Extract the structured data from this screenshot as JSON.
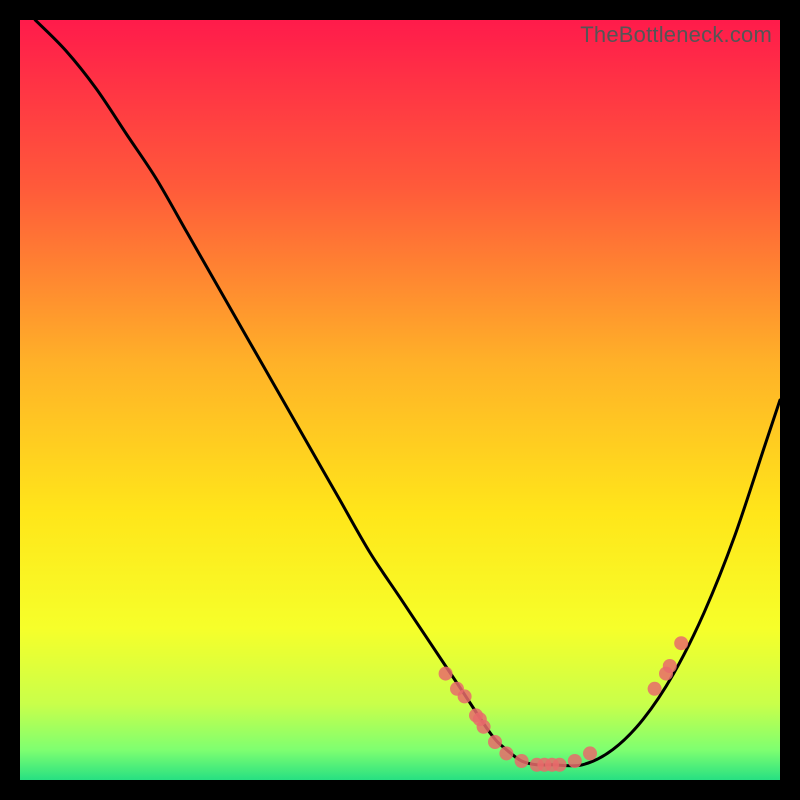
{
  "watermark": "TheBottleneck.com",
  "chart_data": {
    "type": "line",
    "title": "",
    "xlabel": "",
    "ylabel": "",
    "xlim": [
      0,
      100
    ],
    "ylim": [
      0,
      100
    ],
    "grid": false,
    "legend": false,
    "background_gradient": {
      "stops": [
        {
          "offset": 0.0,
          "color": "#ff1b4b"
        },
        {
          "offset": 0.22,
          "color": "#ff5a3a"
        },
        {
          "offset": 0.45,
          "color": "#ffb128"
        },
        {
          "offset": 0.65,
          "color": "#ffe61a"
        },
        {
          "offset": 0.8,
          "color": "#f6ff2a"
        },
        {
          "offset": 0.9,
          "color": "#c9ff4a"
        },
        {
          "offset": 0.96,
          "color": "#7fff70"
        },
        {
          "offset": 1.0,
          "color": "#27e082"
        }
      ]
    },
    "series": [
      {
        "name": "bottleneck-curve",
        "type": "line",
        "color": "#000000",
        "x": [
          2,
          6,
          10,
          14,
          18,
          22,
          26,
          30,
          34,
          38,
          42,
          46,
          50,
          54,
          58,
          62,
          64,
          66,
          68,
          70,
          74,
          78,
          82,
          86,
          90,
          94,
          98,
          100
        ],
        "y": [
          100,
          96,
          91,
          85,
          79,
          72,
          65,
          58,
          51,
          44,
          37,
          30,
          24,
          18,
          12,
          6,
          4,
          2.5,
          2,
          2,
          2,
          4,
          8,
          14,
          22,
          32,
          44,
          50
        ]
      },
      {
        "name": "sample-points",
        "type": "scatter",
        "color": "#e76b6b",
        "x": [
          56,
          57.5,
          58.5,
          60,
          60.5,
          61,
          62.5,
          64,
          66,
          68,
          69,
          70,
          71,
          73,
          75,
          83.5,
          85,
          85.5,
          87
        ],
        "y": [
          14,
          12,
          11,
          8.5,
          8,
          7,
          5,
          3.5,
          2.5,
          2,
          2,
          2,
          2,
          2.5,
          3.5,
          12,
          14,
          15,
          18
        ]
      }
    ]
  }
}
